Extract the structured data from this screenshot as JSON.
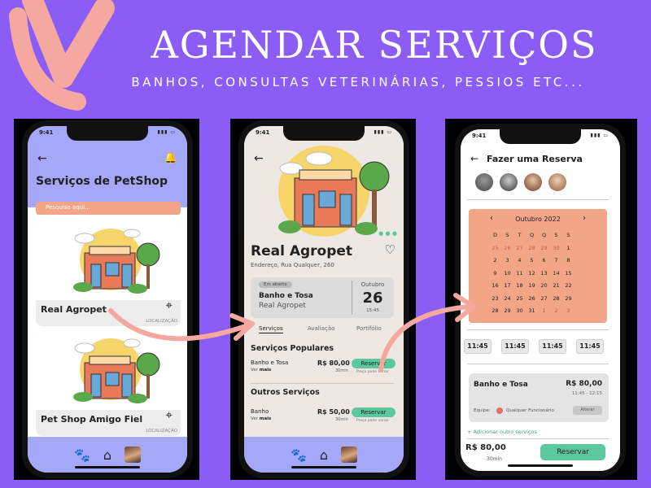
{
  "header": {
    "title": "AGENDAR SERVIÇOS",
    "subtitle": "BANHOS, CONSULTAS VETERINÁRIAS, PESSIOS ETC..."
  },
  "colors": {
    "background": "#8b5cf6",
    "lavender": "#a5a8f8",
    "salmon": "#f2a587",
    "green": "#5cc8a0"
  },
  "phone1": {
    "status_time": "9:41",
    "title": "Serviços de PetShop",
    "search_placeholder": "Pesquise aqui...",
    "shops": [
      {
        "name": "Real Agropet",
        "location_label": "LOCALIZAÇÃO"
      },
      {
        "name": "Pet Shop Amigo Fiel",
        "location_label": "LOCALIZAÇÃO"
      }
    ],
    "nav_icons": [
      "paw-icon",
      "home-icon",
      "profile-avatar"
    ]
  },
  "phone2": {
    "status_time": "9:41",
    "shop_name": "Real Agropet",
    "address": "Endereço, Rua Qualquer, 260",
    "booking": {
      "status": "Em aberto",
      "service": "Banho e Tosa",
      "shop": "Real Agropet",
      "month": "Outubro",
      "day": "26",
      "time": "15:45"
    },
    "tabs": [
      "Serviços",
      "Avaliação",
      "Portifólio"
    ],
    "popular_title": "Serviços Populares",
    "popular": [
      {
        "name": "Banho e Tosa",
        "link_prefix": "Ver ",
        "link_bold": "mais",
        "price": "R$ 80,00",
        "duration": "30min",
        "button": "Reservar",
        "note": "Preço pode variar"
      }
    ],
    "others_title": "Outros Serviços",
    "others": [
      {
        "name": "Banho",
        "link_prefix": "Ver ",
        "link_bold": "mais",
        "price": "R$ 50,00",
        "duration": "30min",
        "button": "Reservar",
        "note": "Preço pode variar"
      }
    ]
  },
  "phone3": {
    "status_time": "9:41",
    "title": "Fazer uma Reserva",
    "calendar": {
      "month": "Outubro 2022",
      "weekdays": [
        "D",
        "S",
        "T",
        "Q",
        "Q",
        "S",
        "S"
      ],
      "days": [
        {
          "d": "25",
          "m": true
        },
        {
          "d": "26",
          "m": true
        },
        {
          "d": "27",
          "m": true
        },
        {
          "d": "28",
          "m": true
        },
        {
          "d": "29",
          "m": true
        },
        {
          "d": "30",
          "m": true
        },
        {
          "d": "1",
          "m": false
        },
        {
          "d": "2",
          "m": false
        },
        {
          "d": "3",
          "m": false
        },
        {
          "d": "4",
          "m": false
        },
        {
          "d": "5",
          "m": false
        },
        {
          "d": "6",
          "m": false
        },
        {
          "d": "7",
          "m": false
        },
        {
          "d": "8",
          "m": false
        },
        {
          "d": "9",
          "m": false
        },
        {
          "d": "10",
          "m": false
        },
        {
          "d": "11",
          "m": false
        },
        {
          "d": "12",
          "m": false
        },
        {
          "d": "13",
          "m": false
        },
        {
          "d": "14",
          "m": false
        },
        {
          "d": "15",
          "m": false
        },
        {
          "d": "16",
          "m": false
        },
        {
          "d": "17",
          "m": false
        },
        {
          "d": "18",
          "m": false
        },
        {
          "d": "19",
          "m": false
        },
        {
          "d": "20",
          "m": false
        },
        {
          "d": "21",
          "m": false
        },
        {
          "d": "22",
          "m": false
        },
        {
          "d": "23",
          "m": false
        },
        {
          "d": "24",
          "m": false
        },
        {
          "d": "25",
          "m": false
        },
        {
          "d": "26",
          "m": false
        },
        {
          "d": "27",
          "m": false
        },
        {
          "d": "28",
          "m": false
        },
        {
          "d": "29",
          "m": false
        },
        {
          "d": "28",
          "m": false
        },
        {
          "d": "29",
          "m": false
        },
        {
          "d": "30",
          "m": false
        },
        {
          "d": "31",
          "m": false
        },
        {
          "d": "1",
          "m": true
        },
        {
          "d": "2",
          "m": true
        },
        {
          "d": "3",
          "m": true
        }
      ]
    },
    "times": [
      "11:45",
      "11:45",
      "11:45",
      "11:45"
    ],
    "summary": {
      "service": "Banho e Tosa",
      "price": "R$ 80,00",
      "time_range": "11:45 - 12:15",
      "team_label": "Equipe:",
      "staff": "Qualquer Funcionário",
      "change_button": "Alterar"
    },
    "add_service": "+ Adicionar outro serviços",
    "total": "R$ 80,00",
    "duration": "30min",
    "reserve_button": "Reservar"
  }
}
